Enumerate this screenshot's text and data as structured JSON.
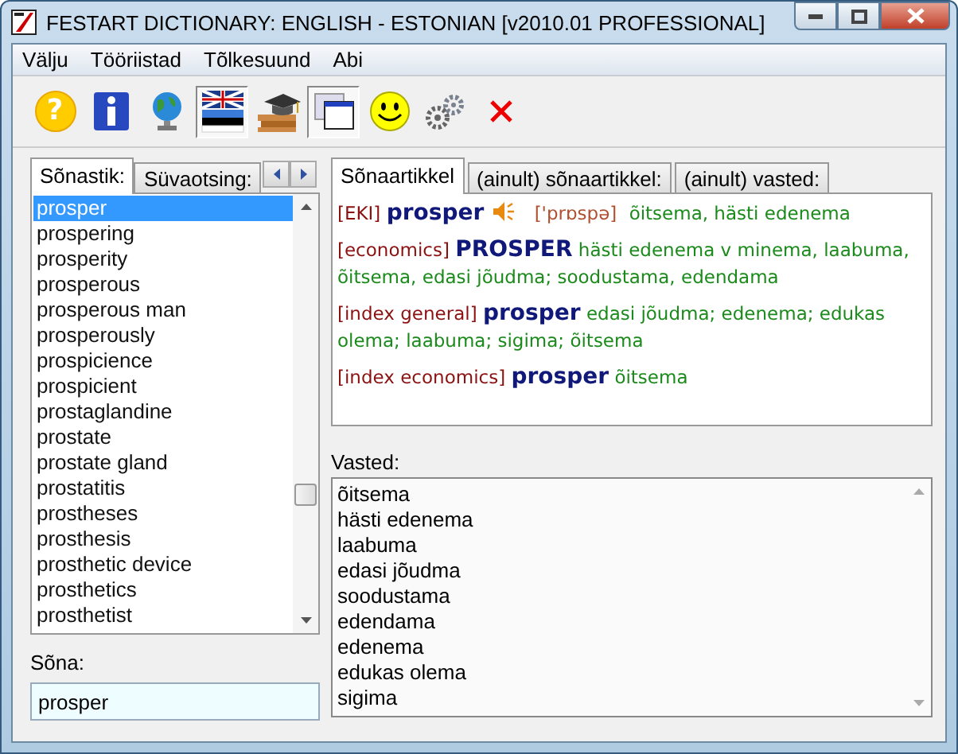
{
  "window": {
    "title": "FESTART DICTIONARY: ENGLISH - ESTONIAN [v2010.01 PROFESSIONAL]"
  },
  "menu": [
    "Välju",
    "Tööriistad",
    "Tõlkesuund",
    "Abi"
  ],
  "toolbar": [
    {
      "kind": "help",
      "symbol": "?",
      "pressed": false
    },
    {
      "kind": "info",
      "pressed": false
    },
    {
      "kind": "globe",
      "pressed": false
    },
    {
      "kind": "flags",
      "pressed": true
    },
    {
      "kind": "books",
      "pressed": false
    },
    {
      "kind": "window",
      "pressed": true
    },
    {
      "kind": "smiley",
      "pressed": false
    },
    {
      "kind": "gears",
      "pressed": false
    },
    {
      "kind": "close",
      "pressed": false
    }
  ],
  "left_tabs": [
    {
      "label": "Sõnastik:",
      "selected": true
    },
    {
      "label": "Süvaotsing:",
      "selected": false
    }
  ],
  "word_list": [
    {
      "text": "prosper",
      "selected": true
    },
    {
      "text": "prospering",
      "selected": false
    },
    {
      "text": "prosperity",
      "selected": false
    },
    {
      "text": "prosperous",
      "selected": false
    },
    {
      "text": "prosperous man",
      "selected": false
    },
    {
      "text": "prosperously",
      "selected": false
    },
    {
      "text": "prospicience",
      "selected": false
    },
    {
      "text": "prospicient",
      "selected": false
    },
    {
      "text": "prostaglandine",
      "selected": false
    },
    {
      "text": "prostate",
      "selected": false
    },
    {
      "text": "prostate gland",
      "selected": false
    },
    {
      "text": "prostatitis",
      "selected": false
    },
    {
      "text": "prostheses",
      "selected": false
    },
    {
      "text": "prosthesis",
      "selected": false
    },
    {
      "text": "prosthetic device",
      "selected": false
    },
    {
      "text": "prosthetics",
      "selected": false
    },
    {
      "text": "prosthetist",
      "selected": false
    }
  ],
  "word_field": {
    "label": "Sõna:",
    "value": "prosper"
  },
  "right_tabs": [
    {
      "label": "Sõnaartikkel",
      "selected": true
    },
    {
      "label": "(ainult) sõnaartikkel:",
      "selected": false
    },
    {
      "label": "(ainult) vasted:",
      "selected": false
    }
  ],
  "article": [
    {
      "source": "[EKI]",
      "headword": "prosper",
      "sound": true,
      "pronunciation": "['prɒspə]",
      "translation": "õitsema, hästi edenema"
    },
    {
      "source": "[economics]",
      "headword": "PROSPER",
      "sound": false,
      "translation": "hästi edenema v minema, laabuma, õitsema, edasi jõudma; soodustama, edendama"
    },
    {
      "source": "[index general]",
      "headword": "prosper",
      "sound": false,
      "translation": "edasi jõudma; edenema; edukas olema; laabuma; sigima; õitsema"
    },
    {
      "source": "[index economics]",
      "headword": "prosper",
      "sound": false,
      "translation": "õitsema"
    }
  ],
  "matches": {
    "label": "Vasted:",
    "items": [
      "õitsema",
      "hästi edenema",
      "laabuma",
      "edasi jõudma",
      "soodustama",
      "edendama",
      "edenema",
      "edukas olema",
      "sigima"
    ]
  }
}
